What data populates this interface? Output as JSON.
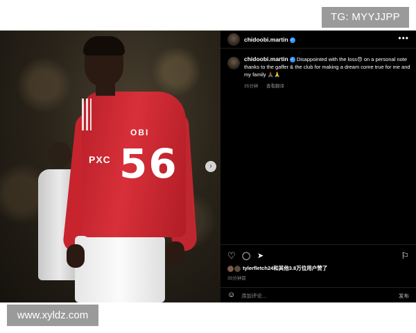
{
  "watermarks": {
    "top_right": "TG: MYYJJPP",
    "bottom_left": "www.xyldz.com"
  },
  "photo": {
    "jersey_name": "OBI",
    "jersey_number": "56",
    "sponsor": "PXC"
  },
  "post": {
    "username": "chidoobi.martin",
    "more_icon": "•••",
    "caption_username": "chidoobi.martin",
    "caption_text": "Disappointed with the loss😞 on a personal note thanks to the gaffer & the club for making a dream come true for me and my family 🙏🏾🙏",
    "time": "35分钟",
    "translate": "查看翻译",
    "likes_text": "tylerfletch24和其他3.8万位用户赞了",
    "posted_time": "35分钟前",
    "comment_placeholder": "添加评论...",
    "post_button": "发布"
  },
  "icons": {
    "next": "›",
    "verified": "✓",
    "heart": "♡",
    "comment": "◯",
    "share": "➤",
    "bookmark": "⚐",
    "emoji": "☺"
  }
}
